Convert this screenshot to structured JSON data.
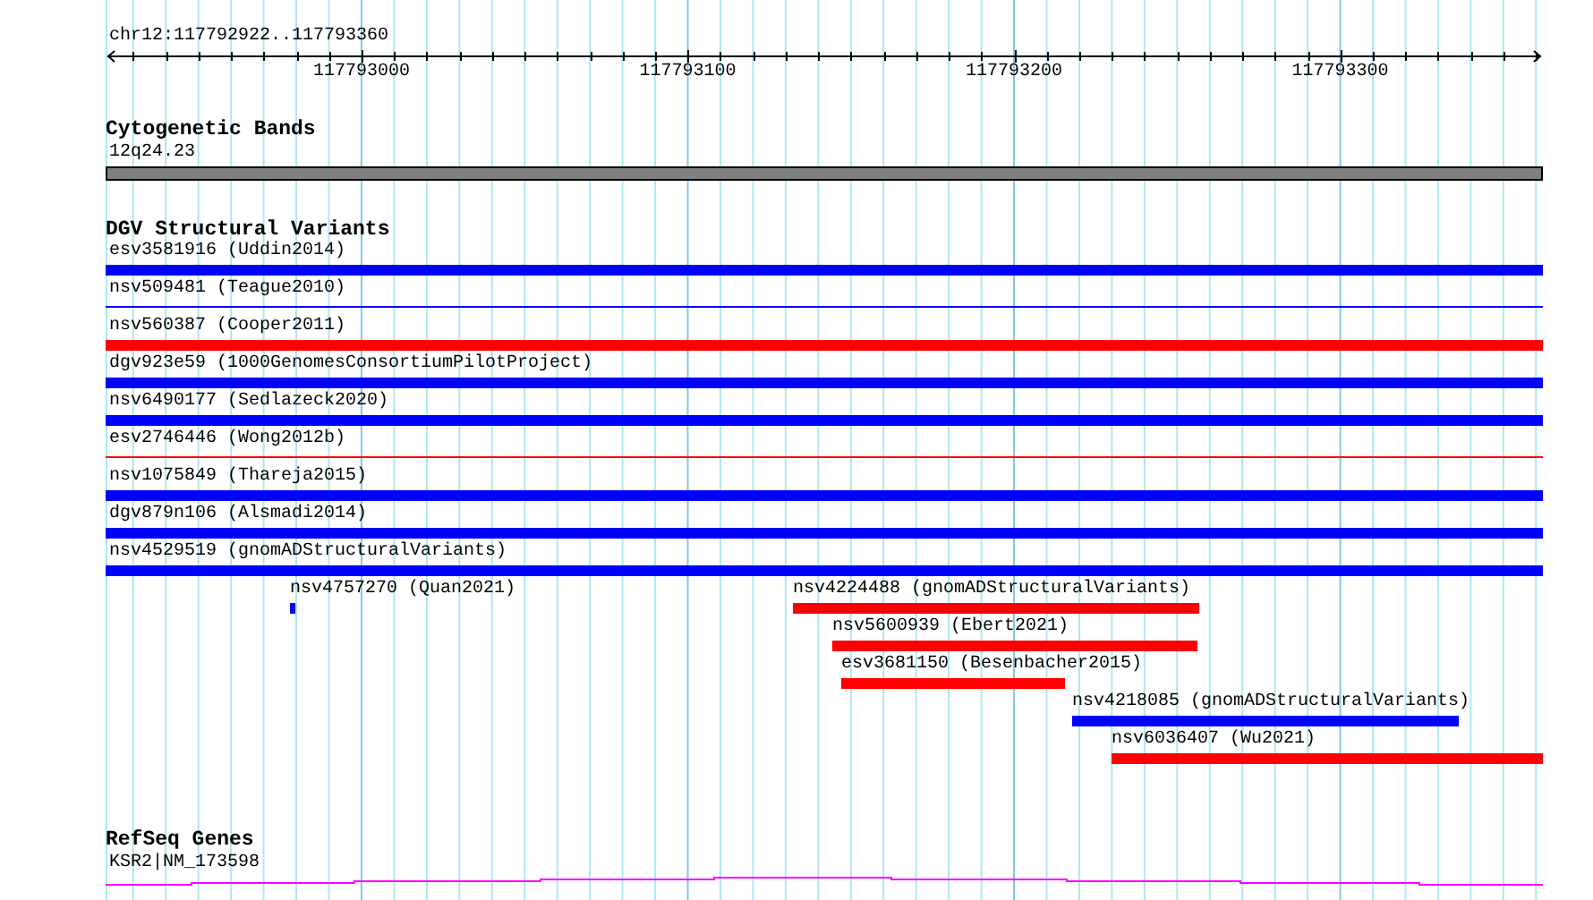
{
  "location": "chr12:117792922..117793360",
  "ruler": {
    "ticks": [
      "117793000",
      "117793100",
      "117793200",
      "117793300"
    ]
  },
  "tracks": [
    {
      "kind": "bands",
      "title": "Cytogenetic Bands",
      "features": [
        {
          "label": "12q24.23"
        }
      ]
    },
    {
      "kind": "variants",
      "title": "DGV Structural Variants",
      "features": [
        {
          "label": "esv3581916 (Uddin2014)",
          "color": "#0000ff",
          "kind": "bar"
        },
        {
          "label": "nsv509481 (Teague2010)",
          "color": "#0000ff",
          "kind": "line"
        },
        {
          "label": "nsv560387 (Cooper2011)",
          "color": "#ff0000",
          "kind": "bar"
        },
        {
          "label": "dgv923e59 (1000GenomesConsortiumPilotProject)",
          "color": "#0000ff",
          "kind": "bar"
        },
        {
          "label": "nsv6490177 (Sedlazeck2020)",
          "color": "#0000ff",
          "kind": "bar"
        },
        {
          "label": "esv2746446 (Wong2012b)",
          "color": "#ff0000",
          "kind": "line"
        },
        {
          "label": "nsv1075849 (Thareja2015)",
          "color": "#0000ff",
          "kind": "bar"
        },
        {
          "label": "dgv879n106 (Alsmadi2014)",
          "color": "#0000ff",
          "kind": "bar"
        },
        {
          "label": "nsv4529519 (gnomADStructuralVariants)",
          "color": "#0000ff",
          "kind": "bar"
        },
        {
          "label": "nsv4757270 (Quan2021)",
          "color": "#0000ff",
          "kind": "bar"
        },
        {
          "label": "nsv4224488 (gnomADStructuralVariants)",
          "color": "#ff0000",
          "kind": "bar"
        },
        {
          "label": "nsv5600939 (Ebert2021)",
          "color": "#ff0000",
          "kind": "bar"
        },
        {
          "label": "esv3681150 (Besenbacher2015)",
          "color": "#ff0000",
          "kind": "bar"
        },
        {
          "label": "nsv4218085 (gnomADStructuralVariants)",
          "color": "#0000ff",
          "kind": "bar"
        },
        {
          "label": "nsv6036407 (Wu2021)",
          "color": "#ff0000",
          "kind": "bar"
        }
      ]
    },
    {
      "kind": "genes",
      "title": "RefSeq Genes",
      "features": [
        {
          "label": "KSR2|NM_173598"
        }
      ]
    }
  ]
}
